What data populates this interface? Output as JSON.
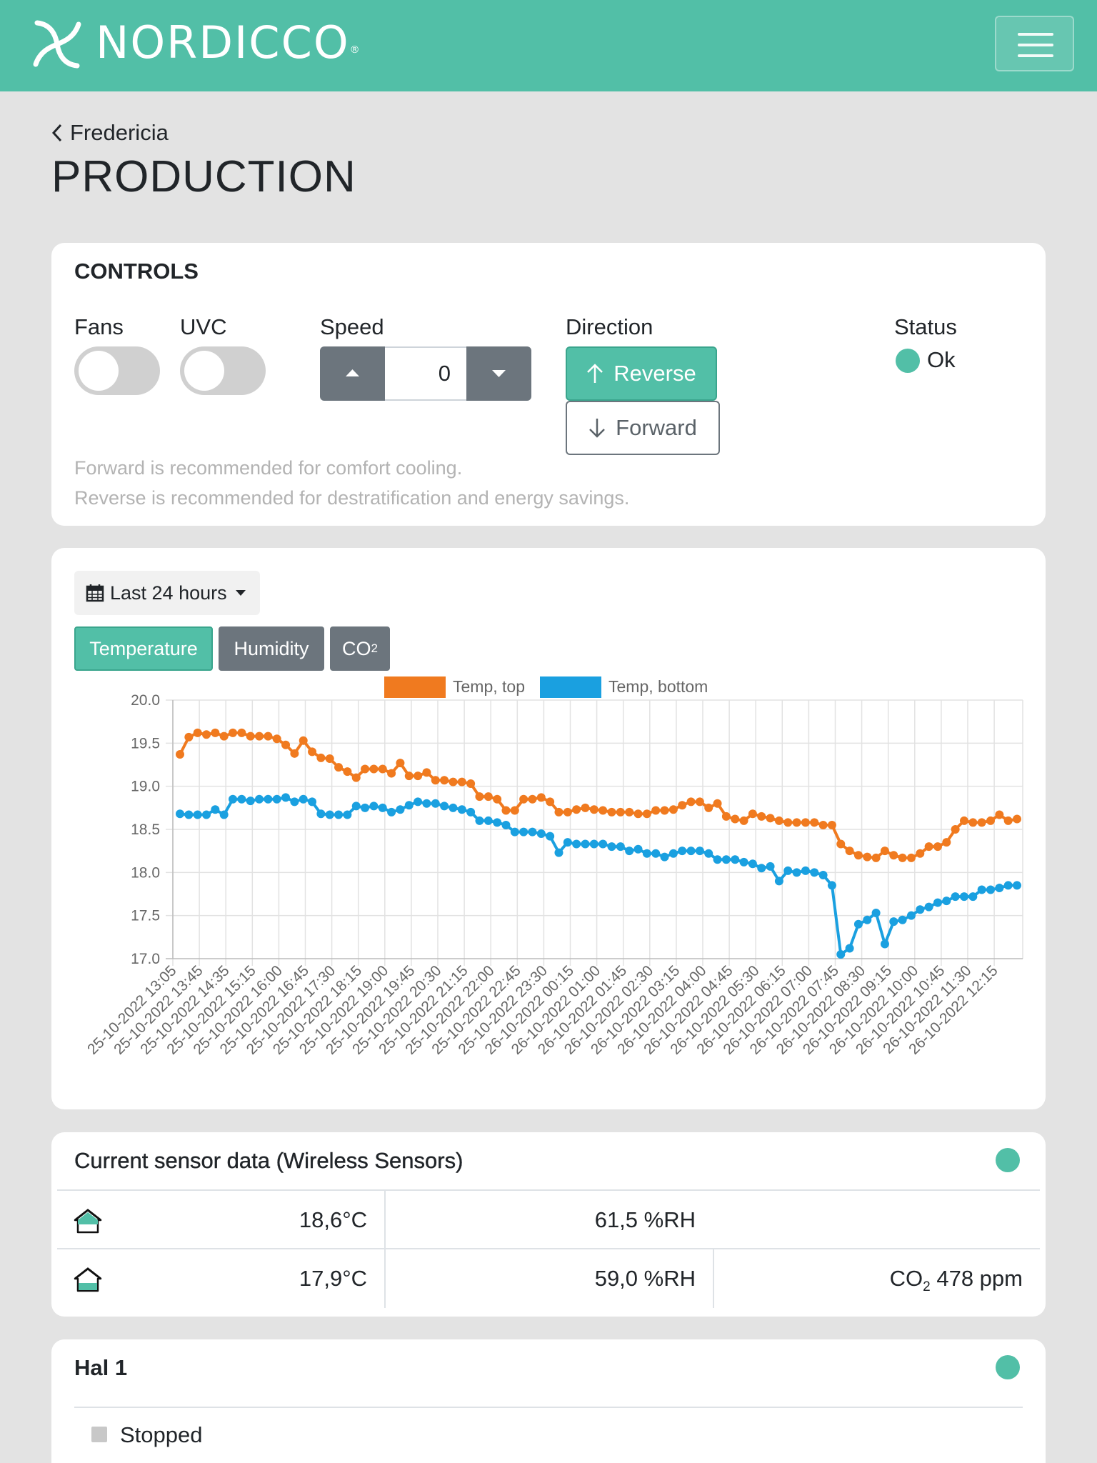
{
  "header": {
    "brand": "NORDICCO",
    "brand_mark": "®",
    "logo_icon": "pinwheel-logo-icon",
    "menu_icon": "hamburger-icon"
  },
  "breadcrumb": {
    "back_label": "Fredericia"
  },
  "page_title": "PRODUCTION",
  "controls": {
    "heading": "CONTROLS",
    "fans_label": "Fans",
    "uvc_label": "UVC",
    "fans_on": false,
    "uvc_on": false,
    "speed_label": "Speed",
    "speed_value": "0",
    "direction_label": "Direction",
    "reverse_label": "Reverse",
    "forward_label": "Forward",
    "status_label": "Status",
    "status_value": "Ok",
    "hint_forward": "Forward is recommended for comfort cooling.",
    "hint_reverse": "Reverse is recommended for destratification and energy savings."
  },
  "chart_panel": {
    "range_label": "Last 24 hours",
    "tabs": {
      "temperature": "Temperature",
      "humidity": "Humidity",
      "co2_main": "CO",
      "co2_sub": "2"
    }
  },
  "chart_data": {
    "type": "line",
    "ylim": [
      17.0,
      20.0
    ],
    "y_ticks": [
      "20.0",
      "19.5",
      "19.0",
      "18.5",
      "18.0",
      "17.5",
      "17.0"
    ],
    "x_tick_labels": [
      "25-10-2022 13:05",
      "25-10-2022 13:45",
      "25-10-2022 14:35",
      "25-10-2022 15:15",
      "25-10-2022 16:00",
      "25-10-2022 16:45",
      "25-10-2022 17:30",
      "25-10-2022 18:15",
      "25-10-2022 19:00",
      "25-10-2022 19:45",
      "25-10-2022 20:30",
      "25-10-2022 21:15",
      "25-10-2022 22:00",
      "25-10-2022 22:45",
      "25-10-2022 23:30",
      "26-10-2022 00:15",
      "26-10-2022 01:00",
      "26-10-2022 01:45",
      "26-10-2022 02:30",
      "26-10-2022 03:15",
      "26-10-2022 04:00",
      "26-10-2022 04:45",
      "26-10-2022 05:30",
      "26-10-2022 06:15",
      "26-10-2022 07:00",
      "26-10-2022 07:45",
      "26-10-2022 08:30",
      "26-10-2022 09:15",
      "26-10-2022 10:00",
      "26-10-2022 10:45",
      "26-10-2022 11:30",
      "26-10-2022 12:15"
    ],
    "series": [
      {
        "name": "Temp, top",
        "color": "#f07a1f",
        "values": [
          19.37,
          19.57,
          19.62,
          19.6,
          19.62,
          19.58,
          19.62,
          19.62,
          19.58,
          19.58,
          19.58,
          19.55,
          19.48,
          19.38,
          19.53,
          19.4,
          19.33,
          19.32,
          19.22,
          19.17,
          19.1,
          19.2,
          19.2,
          19.2,
          19.15,
          19.27,
          19.12,
          19.12,
          19.16,
          19.07,
          19.07,
          19.05,
          19.05,
          19.03,
          18.88,
          18.88,
          18.85,
          18.72,
          18.72,
          18.85,
          18.85,
          18.87,
          18.82,
          18.7,
          18.7,
          18.73,
          18.75,
          18.73,
          18.72,
          18.7,
          18.7,
          18.7,
          18.68,
          18.68,
          18.72,
          18.72,
          18.73,
          18.78,
          18.82,
          18.82,
          18.75,
          18.8,
          18.65,
          18.62,
          18.6,
          18.68,
          18.65,
          18.63,
          18.6,
          18.58,
          18.58,
          18.58,
          18.58,
          18.55,
          18.55,
          18.33,
          18.25,
          18.2,
          18.18,
          18.17,
          18.25,
          18.2,
          18.17,
          18.17,
          18.22,
          18.3,
          18.3,
          18.35,
          18.5,
          18.6,
          18.58,
          18.58,
          18.6,
          18.67,
          18.6,
          18.62
        ]
      },
      {
        "name": "Temp, bottom",
        "color": "#1aa0e0",
        "values": [
          18.68,
          18.67,
          18.67,
          18.67,
          18.73,
          18.67,
          18.85,
          18.85,
          18.83,
          18.85,
          18.85,
          18.85,
          18.87,
          18.82,
          18.85,
          18.82,
          18.68,
          18.67,
          18.67,
          18.67,
          18.77,
          18.75,
          18.77,
          18.75,
          18.7,
          18.73,
          18.78,
          18.82,
          18.8,
          18.8,
          18.77,
          18.75,
          18.73,
          18.7,
          18.6,
          18.6,
          18.58,
          18.55,
          18.47,
          18.47,
          18.47,
          18.45,
          18.42,
          18.23,
          18.35,
          18.33,
          18.33,
          18.33,
          18.33,
          18.3,
          18.3,
          18.25,
          18.27,
          18.22,
          18.22,
          18.18,
          18.22,
          18.25,
          18.25,
          18.25,
          18.22,
          18.15,
          18.15,
          18.15,
          18.12,
          18.1,
          18.05,
          18.07,
          17.9,
          18.02,
          18.0,
          18.02,
          18.0,
          17.97,
          17.85,
          17.05,
          17.12,
          17.4,
          17.45,
          17.53,
          17.17,
          17.43,
          17.45,
          17.5,
          17.57,
          17.6,
          17.65,
          17.67,
          17.72,
          17.72,
          17.72,
          17.8,
          17.8,
          17.82,
          17.85,
          17.85
        ]
      }
    ]
  },
  "sensors": {
    "heading": "Current sensor data (Wireless Sensors)",
    "rows": [
      {
        "icon": "house-top-sensor-icon",
        "temp": "18,6°C",
        "humidity": "61,5 %RH",
        "co2": ""
      },
      {
        "icon": "house-bottom-sensor-icon",
        "temp": "17,9°C",
        "humidity": "59,0 %RH",
        "co2_prefix": "CO",
        "co2_sub": "2",
        "co2_value": " 478 ppm"
      }
    ]
  },
  "hal": {
    "heading": "Hal 1",
    "state": "Stopped"
  },
  "colors": {
    "accent": "#52bfa7",
    "secondary": "#6c757d",
    "top_series": "#f07a1f",
    "bottom_series": "#1aa0e0"
  }
}
